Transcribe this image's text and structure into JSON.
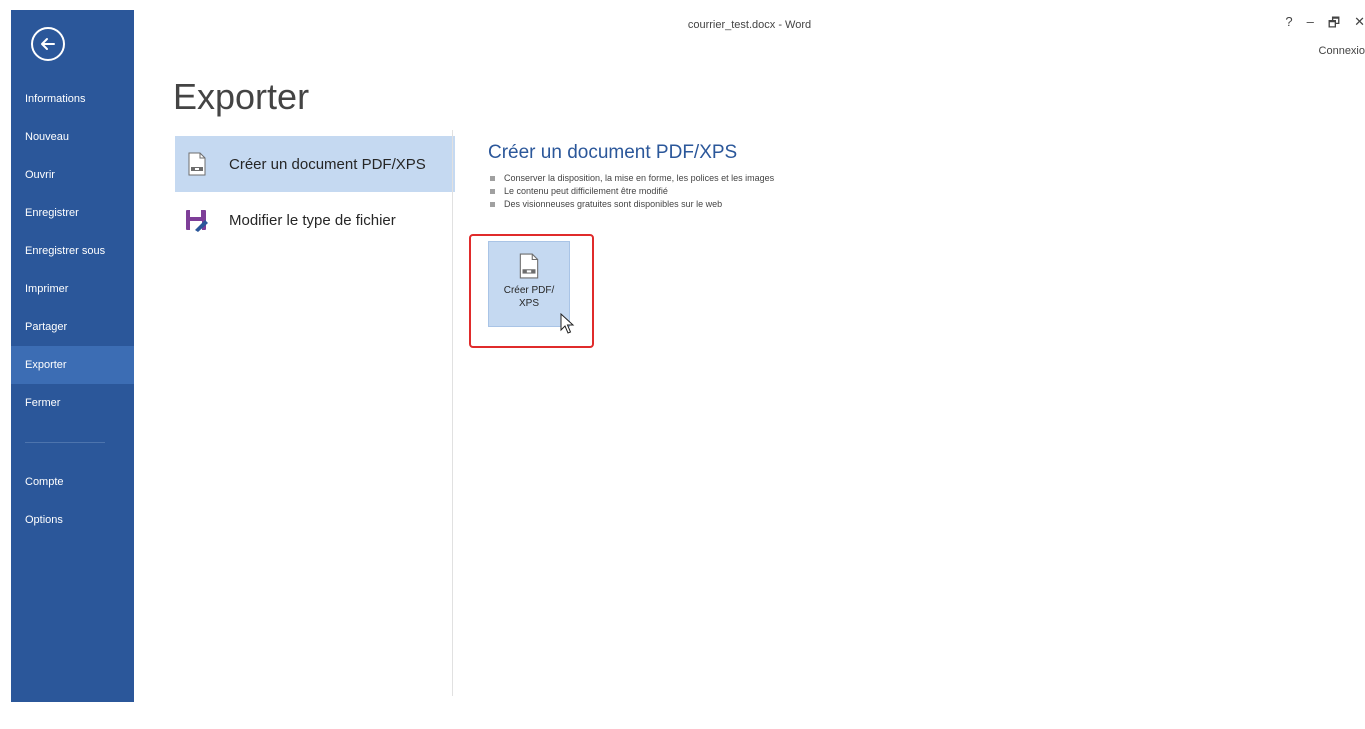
{
  "window": {
    "title": "courrier_test.docx - Word",
    "controls": {
      "help": "?",
      "minimize": "–",
      "restore": "🗗",
      "close": "✕"
    },
    "signin": "Connexio"
  },
  "sidebar": {
    "back_icon": "back-arrow-icon",
    "items": [
      {
        "label": "Informations"
      },
      {
        "label": "Nouveau"
      },
      {
        "label": "Ouvrir"
      },
      {
        "label": "Enregistrer"
      },
      {
        "label": "Enregistrer sous"
      },
      {
        "label": "Imprimer"
      },
      {
        "label": "Partager"
      },
      {
        "label": "Exporter",
        "active": true
      },
      {
        "label": "Fermer"
      }
    ],
    "bottom_items": [
      {
        "label": "Compte"
      },
      {
        "label": "Options"
      }
    ]
  },
  "main": {
    "title": "Exporter",
    "options": [
      {
        "label": "Créer un document PDF/XPS",
        "icon": "pdf-document-icon",
        "active": true
      },
      {
        "label": "Modifier le type de fichier",
        "icon": "change-file-type-icon"
      }
    ],
    "detail": {
      "heading": "Créer un document PDF/XPS",
      "bullets": [
        "Conserver la disposition, la mise en forme, les polices et les images",
        "Le contenu peut difficilement être modifié",
        "Des visionneuses gratuites sont disponibles sur le web"
      ],
      "button_label": "Créer PDF/ XPS"
    }
  },
  "colors": {
    "sidebar": "#2b579a",
    "sidebar_active": "#3c6db4",
    "selection": "#c5d9f1",
    "heading_blue": "#2b579a",
    "highlight_red": "#e02b2b"
  }
}
